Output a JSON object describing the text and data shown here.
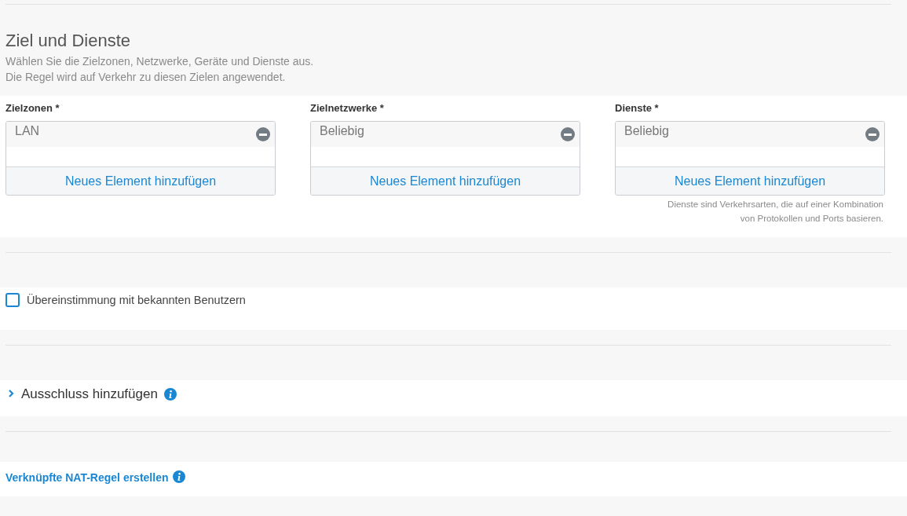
{
  "section": {
    "title": "Ziel und Dienste",
    "description": [
      "Wählen Sie die Zielzonen, Netzwerke, Geräte und Dienste aus.",
      "Die Regel wird auf Verkehr zu diesen Zielen angewendet."
    ]
  },
  "fields": [
    {
      "label": "Zielzonen *",
      "items": [
        "LAN"
      ],
      "add_label": "Neues Element hinzufügen"
    },
    {
      "label": "Zielnetzwerke *",
      "items": [
        "Beliebig"
      ],
      "add_label": "Neues Element hinzufügen"
    },
    {
      "label": "Dienste *",
      "items": [
        "Beliebig"
      ],
      "add_label": "Neues Element hinzufügen",
      "hint": [
        "Dienste sind Verkehrsarten, die auf einer Kombination",
        "von Protokollen und Ports basieren."
      ]
    }
  ],
  "known_users": {
    "label": "Übereinstimmung mit bekannten Benutzern",
    "checked": false
  },
  "exclusion": {
    "label": "Ausschluss hinzufügen",
    "expanded": false
  },
  "nat_link": {
    "label": "Verknüpfte NAT-Regel erstellen"
  }
}
